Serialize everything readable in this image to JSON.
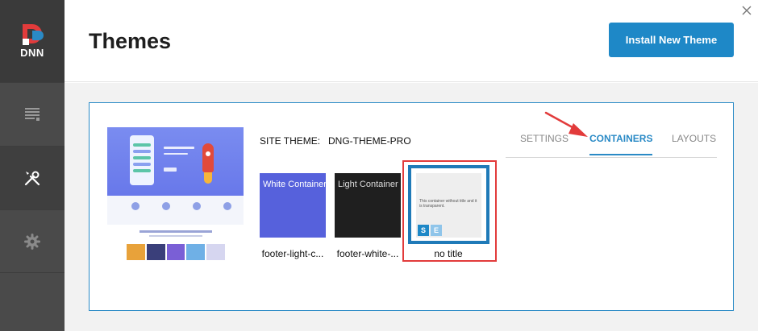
{
  "app": {
    "logo_text": "DNN"
  },
  "header": {
    "title": "Themes",
    "install_label": "Install New Theme"
  },
  "sidebar": {
    "items": [
      {
        "icon": "content-icon"
      },
      {
        "icon": "tools-icon"
      },
      {
        "icon": "gear-icon"
      }
    ]
  },
  "site_theme": {
    "label": "SITE THEME:",
    "value": "DNG-THEME-PRO"
  },
  "tabs": [
    {
      "label": "SETTINGS",
      "active": false
    },
    {
      "label": "CONTAINERS",
      "active": true
    },
    {
      "label": "LAYOUTS",
      "active": false
    }
  ],
  "containers": [
    {
      "thumb_title": "White Container",
      "label": "footer-light-c...",
      "color": "#5661dc"
    },
    {
      "thumb_title": "Light Container",
      "label": "footer-white-...",
      "color": "#1f1f1f"
    },
    {
      "thumb_desc": "This container without title and it is transparent.",
      "label": "no title",
      "badge_s": "S",
      "badge_e": "E",
      "selected": true
    }
  ],
  "colors": {
    "accent": "#1e88c7",
    "highlight": "#e23b3b",
    "sidebar": "#4a4a4a"
  }
}
